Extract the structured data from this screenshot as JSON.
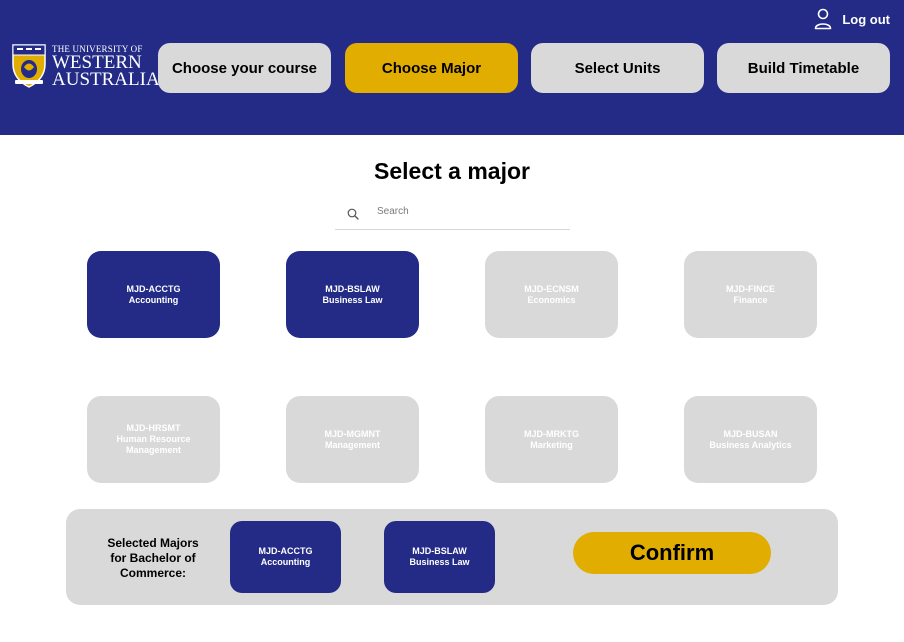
{
  "header": {
    "logo": {
      "line1": "THE UNIVERSITY OF",
      "line2": "WESTERN",
      "line3": "AUSTRALIA"
    },
    "logout_label": "Log out",
    "steps": [
      {
        "label": "Choose your course",
        "active": false
      },
      {
        "label": "Choose Major",
        "active": true
      },
      {
        "label": "Select Units",
        "active": false
      },
      {
        "label": "Build Timetable",
        "active": false
      }
    ]
  },
  "main": {
    "title": "Select a major",
    "search_placeholder": "Search",
    "majors": [
      {
        "code": "MJD-ACCTG",
        "name": "Accounting",
        "selected": true
      },
      {
        "code": "MJD-BSLAW",
        "name": "Business Law",
        "selected": true
      },
      {
        "code": "MJD-ECNSM",
        "name": "Economics",
        "selected": false
      },
      {
        "code": "MJD-FINCE",
        "name": "Finance",
        "selected": false
      },
      {
        "code": "MJD-HRSMT",
        "name": "Human Resource Management",
        "selected": false
      },
      {
        "code": "MJD-MGMNT",
        "name": "Management",
        "selected": false
      },
      {
        "code": "MJD-MRKTG",
        "name": "Marketing",
        "selected": false
      },
      {
        "code": "MJD-BUSAN",
        "name": "Business Analytics",
        "selected": false
      }
    ]
  },
  "selection": {
    "label": "Selected Majors for Bachelor of Commerce:",
    "chips": [
      {
        "code": "MJD-ACCTG",
        "name": "Accounting"
      },
      {
        "code": "MJD-BSLAW",
        "name": "Business Law"
      }
    ],
    "confirm_label": "Confirm"
  },
  "colors": {
    "brand_blue": "#232b86",
    "accent_gold": "#e0ad00",
    "inactive_grey": "#d9d9d9"
  }
}
